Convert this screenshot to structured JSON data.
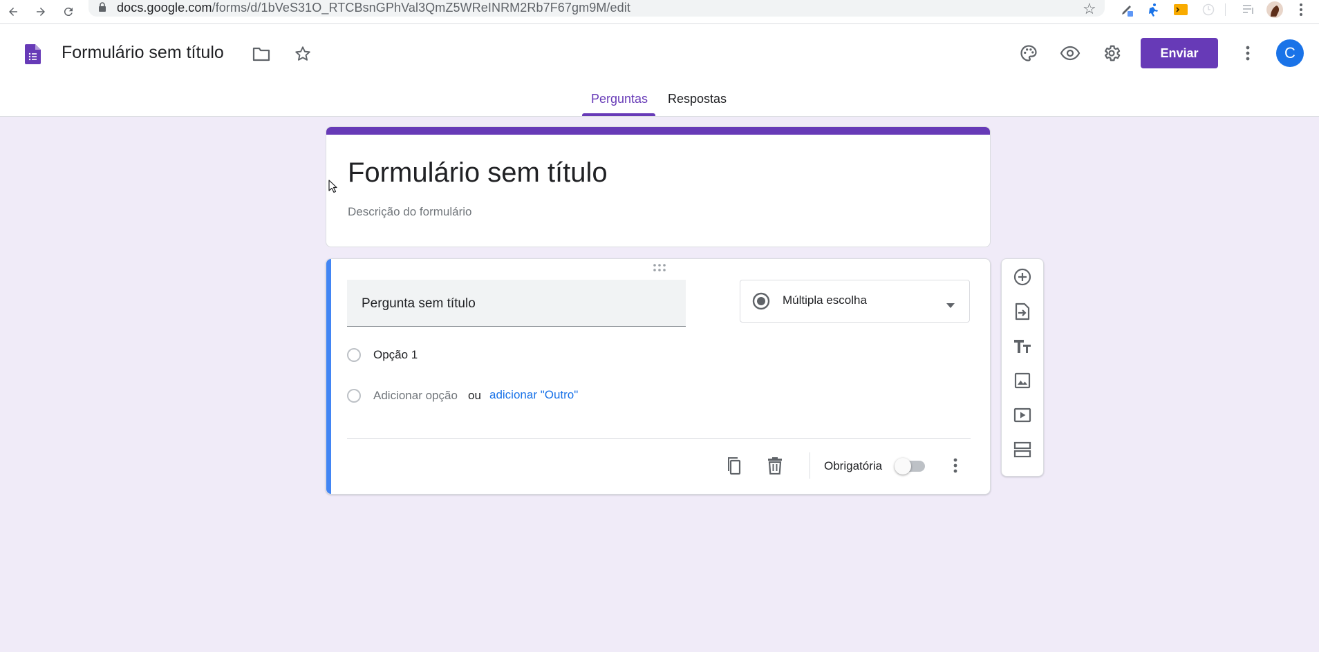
{
  "browser": {
    "url_domain": "docs.google.com",
    "url_path": "/forms/d/1bVeS31O_RTCBsnGPhVal3QmZ5WReINRM2Rb7F67gm9M/edit"
  },
  "header": {
    "doc_title": "Formulário sem título",
    "send_label": "Enviar",
    "avatar_initial": "C",
    "tabs": [
      "Perguntas",
      "Respostas"
    ]
  },
  "form": {
    "title": "Formulário sem título",
    "description_placeholder": "Descrição do formulário"
  },
  "question": {
    "title": "Pergunta sem título",
    "type_label": "Múltipla escolha",
    "options": [
      "Opção 1"
    ],
    "add_option_label": "Adicionar opção",
    "or_label": "ou",
    "add_other_label": "adicionar \"Outro\"",
    "required_label": "Obrigatória",
    "required": false
  },
  "colors": {
    "accent": "#673ab7",
    "background": "#f0ebf8",
    "question_highlight": "#4285f4",
    "link": "#1a73e8"
  },
  "icons": {
    "browser": [
      "back-arrow-icon",
      "forward-arrow-icon",
      "reload-icon",
      "lock-icon",
      "bookmark-star-icon"
    ],
    "header": [
      "forms-logo-icon",
      "folder-icon",
      "star-icon",
      "palette-icon",
      "preview-eye-icon",
      "settings-gear-icon",
      "more-vert-icon"
    ],
    "question_footer": [
      "duplicate-icon",
      "delete-icon",
      "more-vert-icon"
    ],
    "side_toolbar": [
      "add-question-icon",
      "import-questions-icon",
      "add-title-icon",
      "add-image-icon",
      "add-video-icon",
      "add-section-icon"
    ]
  }
}
